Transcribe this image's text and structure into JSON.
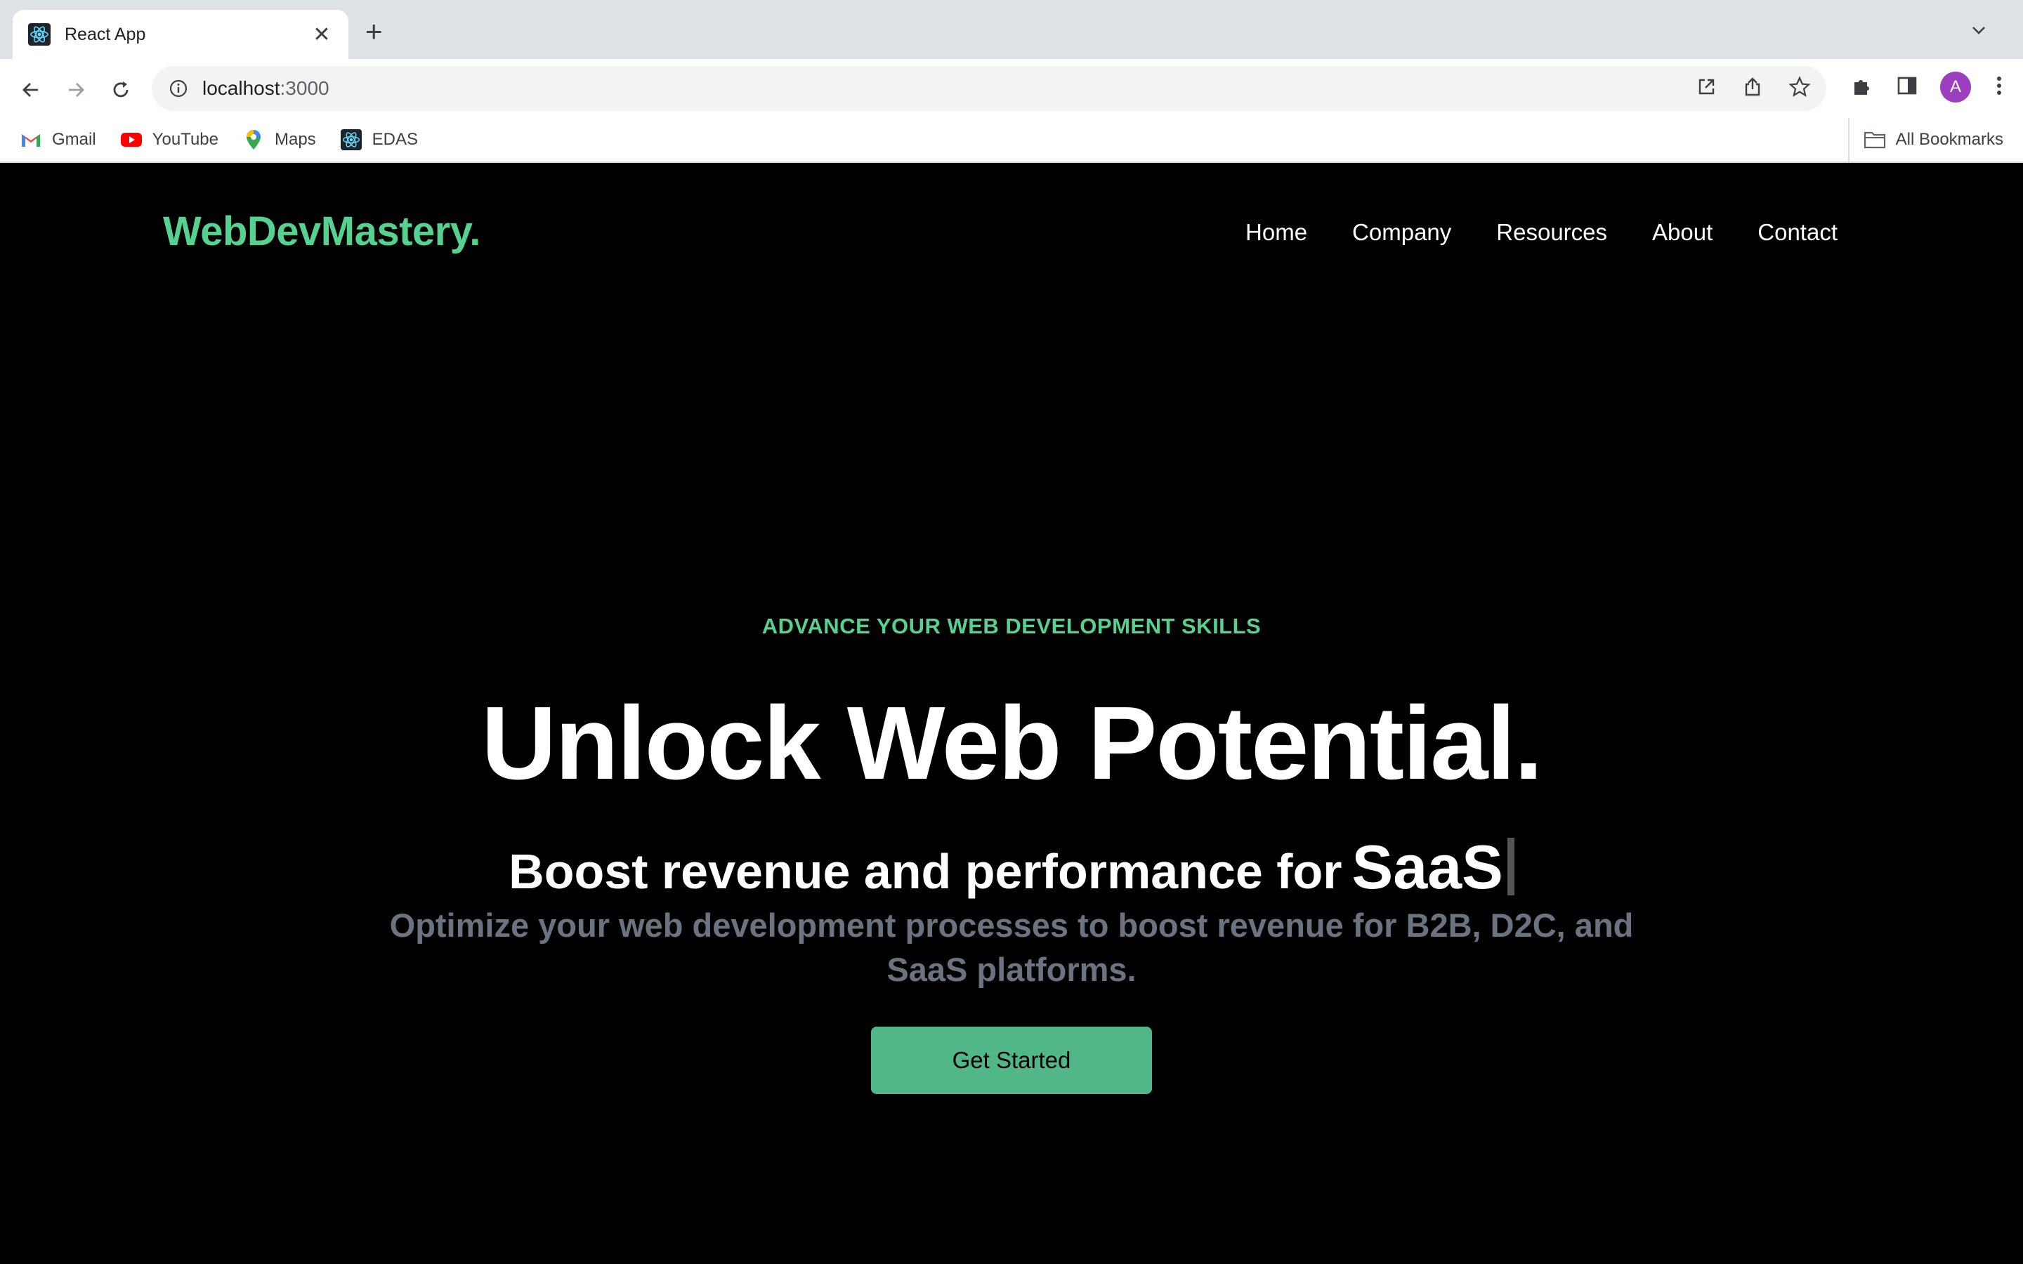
{
  "browser": {
    "tab": {
      "title": "React App",
      "close": "✕"
    },
    "new_tab": "+",
    "address": {
      "host": "localhost",
      "port": ":3000"
    },
    "profile_initial": "A",
    "bookmarks": [
      {
        "label": "Gmail",
        "icon": "gmail-icon"
      },
      {
        "label": "YouTube",
        "icon": "youtube-icon"
      },
      {
        "label": "Maps",
        "icon": "maps-icon"
      },
      {
        "label": "EDAS",
        "icon": "react-icon"
      }
    ],
    "all_bookmarks": "All Bookmarks"
  },
  "site": {
    "logo": "WebDevMastery.",
    "nav": [
      "Home",
      "Company",
      "Resources",
      "About",
      "Contact"
    ],
    "hero": {
      "eyebrow": "ADVANCE YOUR WEB DEVELOPMENT SKILLS",
      "headline": "Unlock Web Potential.",
      "subhead": "Boost revenue and performance for",
      "typed_word": "SaaS",
      "description": "Optimize your web development processes to boost revenue for B2B, D2C, and SaaS platforms.",
      "cta": "Get Started"
    }
  },
  "colors": {
    "accent": "#55d190",
    "button": "#52b788",
    "muted_text": "#6b7280",
    "background": "#000000"
  }
}
